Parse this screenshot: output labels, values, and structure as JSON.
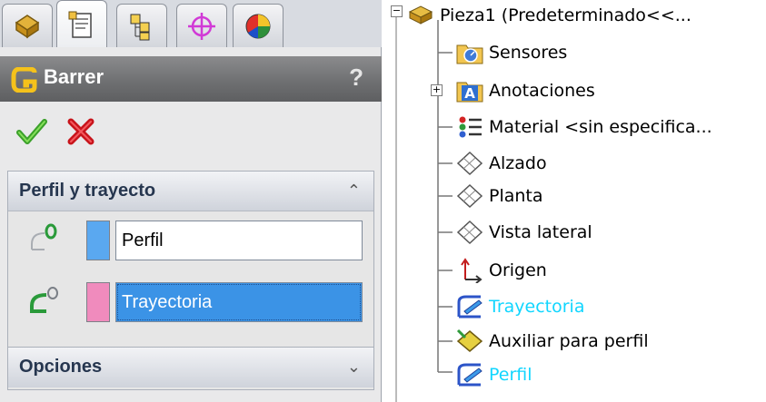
{
  "panel": {
    "title": "Barrer",
    "help": "?",
    "tabs": [
      "feature-manager",
      "property-manager",
      "configuration-manager",
      "dimxpert-manager",
      "display-manager"
    ],
    "groups": {
      "profile_path": {
        "label": "Perfil y trayecto",
        "profile_value": "Perfil",
        "path_value": "Trayectoria",
        "profile_color": "#5aa8f0",
        "path_color": "#f08bbd"
      },
      "options": {
        "label": "Opciones"
      }
    }
  },
  "tree": {
    "items": [
      {
        "label": "Pieza1  (Predeterminado<<...",
        "icon": "part-icon"
      },
      {
        "label": "Sensores",
        "icon": "sensor-folder-icon"
      },
      {
        "label": "Anotaciones",
        "icon": "annotations-icon"
      },
      {
        "label": "Material <sin especifica...",
        "icon": "material-icon"
      },
      {
        "label": "Alzado",
        "icon": "plane-icon"
      },
      {
        "label": "Planta",
        "icon": "plane-icon"
      },
      {
        "label": "Vista lateral",
        "icon": "plane-icon"
      },
      {
        "label": "Origen",
        "icon": "origin-icon"
      },
      {
        "label": "Trayectoria",
        "icon": "sketch-icon"
      },
      {
        "label": "Auxiliar para perfil",
        "icon": "ref-plane-icon"
      },
      {
        "label": "Perfil",
        "icon": "sketch-icon"
      }
    ],
    "highlight_color": "#11d6ff"
  }
}
